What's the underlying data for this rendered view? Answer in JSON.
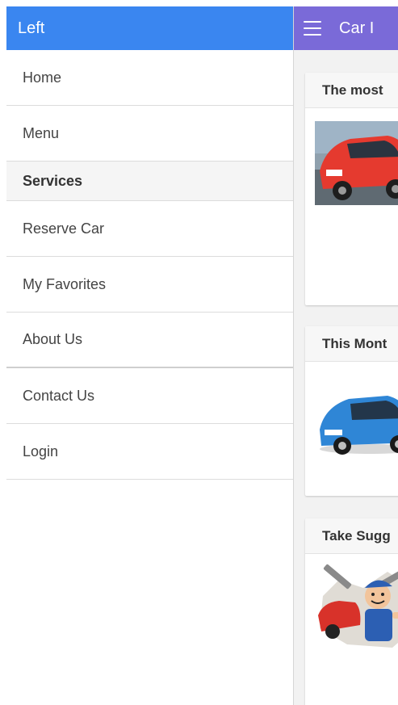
{
  "menu": {
    "title": "Left",
    "items": [
      {
        "label": "Home"
      },
      {
        "label": "Menu"
      }
    ],
    "section_title": "Services",
    "service_items": [
      {
        "label": "Reserve Car"
      },
      {
        "label": "My Favorites"
      },
      {
        "label": "About Us"
      },
      {
        "label": "Contact Us"
      },
      {
        "label": "Login"
      }
    ]
  },
  "main": {
    "title": "Car I",
    "cards": [
      {
        "title": "The most",
        "image": "red-car-image"
      },
      {
        "title": "This Mont",
        "image": "blue-car-image"
      },
      {
        "title": "Take Sugg",
        "image": "mechanic-cartoon-image"
      }
    ]
  },
  "colors": {
    "menu_header": "#3a86f0",
    "main_header": "#7a6ad8",
    "content_bg": "#f2f2f2"
  }
}
